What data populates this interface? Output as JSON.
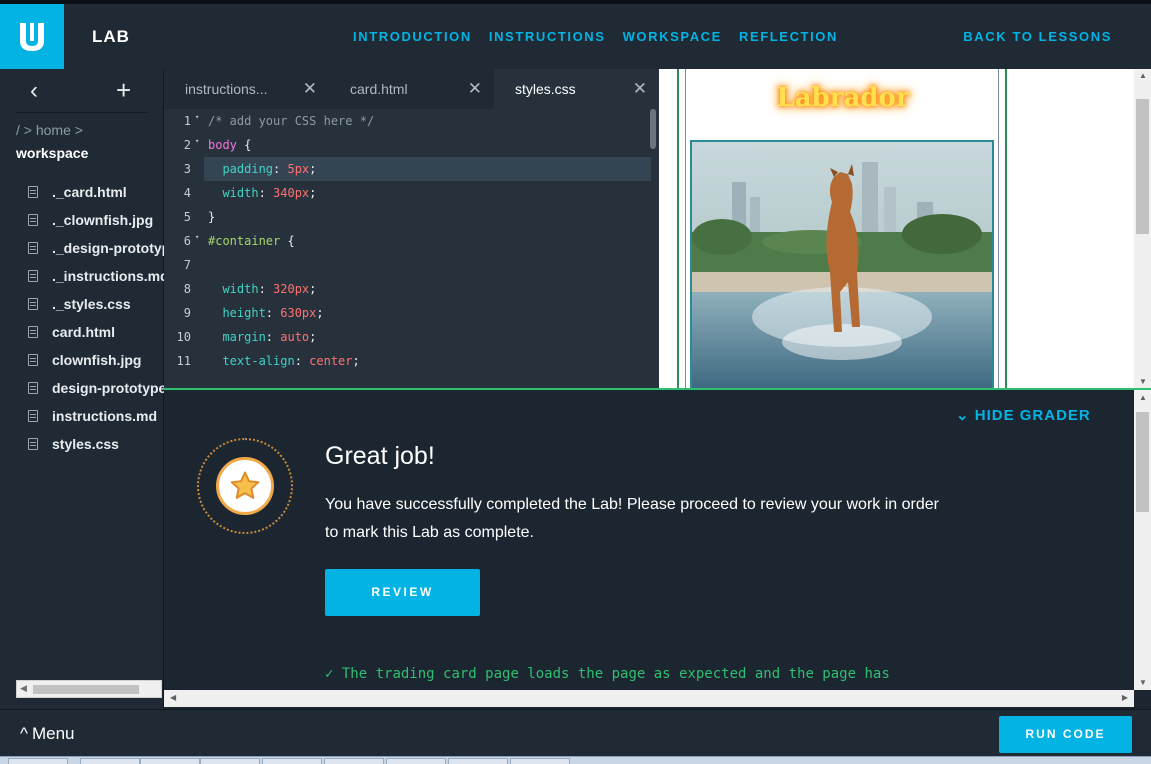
{
  "header": {
    "app_title": "LAB",
    "nav": [
      "INTRODUCTION",
      "INSTRUCTIONS",
      "WORKSPACE",
      "REFLECTION"
    ],
    "back_label": "BACK TO LESSONS",
    "logo_icon": "udacity-logo-icon",
    "accent_color": "#02b3e4"
  },
  "sidebar": {
    "back_icon": "chevron-left-icon",
    "add_icon": "plus-icon",
    "breadcrumb": "/ > home >",
    "current_folder": "workspace",
    "files": [
      "._card.html",
      "._clownfish.jpg",
      "._design-prototype",
      "._instructions.md",
      "._styles.css",
      "card.html",
      "clownfish.jpg",
      "design-prototype",
      "instructions.md",
      "styles.css"
    ]
  },
  "editor": {
    "tabs": [
      {
        "label": "instructions...",
        "active": false
      },
      {
        "label": "card.html",
        "active": false
      },
      {
        "label": "styles.css",
        "active": true
      }
    ],
    "lines": [
      {
        "n": "1",
        "fold": true,
        "tokens": [
          {
            "t": "/* add your CSS here */",
            "c": "c-com"
          }
        ]
      },
      {
        "n": "2",
        "fold": true,
        "tokens": [
          {
            "t": "body",
            "c": "c-sel"
          },
          {
            "t": " {",
            "c": "c-p"
          }
        ]
      },
      {
        "n": "3",
        "fold": false,
        "hl": true,
        "tokens": [
          {
            "t": "  padding",
            "c": "c-prop"
          },
          {
            "t": ": ",
            "c": "c-p"
          },
          {
            "t": "5px",
            "c": "c-val"
          },
          {
            "t": ";",
            "c": "c-p"
          }
        ]
      },
      {
        "n": "4",
        "fold": false,
        "tokens": [
          {
            "t": "  width",
            "c": "c-prop"
          },
          {
            "t": ": ",
            "c": "c-p"
          },
          {
            "t": "340px",
            "c": "c-val"
          },
          {
            "t": ";",
            "c": "c-p"
          }
        ]
      },
      {
        "n": "5",
        "fold": false,
        "tokens": [
          {
            "t": "}",
            "c": "c-p"
          }
        ]
      },
      {
        "n": "6",
        "fold": true,
        "tokens": [
          {
            "t": "#container",
            "c": "c-id"
          },
          {
            "t": " {",
            "c": "c-p"
          }
        ]
      },
      {
        "n": "7",
        "fold": false,
        "tokens": []
      },
      {
        "n": "8",
        "fold": false,
        "tokens": [
          {
            "t": "  width",
            "c": "c-prop"
          },
          {
            "t": ": ",
            "c": "c-p"
          },
          {
            "t": "320px",
            "c": "c-val"
          },
          {
            "t": ";",
            "c": "c-p"
          }
        ]
      },
      {
        "n": "9",
        "fold": false,
        "tokens": [
          {
            "t": "  height",
            "c": "c-prop"
          },
          {
            "t": ": ",
            "c": "c-p"
          },
          {
            "t": "630px",
            "c": "c-val"
          },
          {
            "t": ";",
            "c": "c-p"
          }
        ]
      },
      {
        "n": "10",
        "fold": false,
        "tokens": [
          {
            "t": "  margin",
            "c": "c-prop"
          },
          {
            "t": ": ",
            "c": "c-p"
          },
          {
            "t": "auto",
            "c": "c-val"
          },
          {
            "t": ";",
            "c": "c-p"
          }
        ]
      },
      {
        "n": "11",
        "fold": false,
        "tokens": [
          {
            "t": "  text-align",
            "c": "c-prop"
          },
          {
            "t": ": ",
            "c": "c-p"
          },
          {
            "t": "center",
            "c": "c-val"
          },
          {
            "t": ";",
            "c": "c-p"
          }
        ]
      }
    ]
  },
  "preview": {
    "card_title": "Labrador",
    "image_subject": "dog-running-through-water-image"
  },
  "grader": {
    "toggle_label": "HIDE GRADER",
    "badge_icon": "star-icon",
    "title": "Great job!",
    "message": "You have successfully completed the Lab! Please proceed to review your work in order to mark this Lab as complete.",
    "review_label": "REVIEW",
    "check_mark": "✓",
    "check_text": "The trading card page loads the page as expected and the page has"
  },
  "footer": {
    "menu_label": "Menu",
    "run_label": "RUN CODE"
  }
}
